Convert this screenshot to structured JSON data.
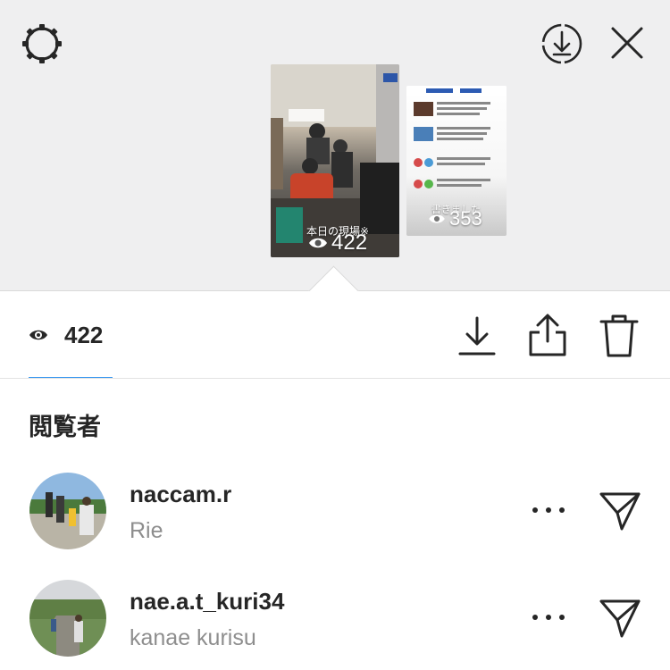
{
  "top": {
    "story_main": {
      "caption": "本日の現場※",
      "views": "422"
    },
    "story_side": {
      "caption": "書きました",
      "views": "353"
    }
  },
  "stats": {
    "views": "422"
  },
  "viewers": {
    "heading": "閲覧者",
    "items": [
      {
        "username": "naccam.r",
        "full_name": "Rie"
      },
      {
        "username": "nae.a.t_kuri34",
        "full_name": "kanae kurisu"
      }
    ]
  },
  "icons": {
    "settings": "gear-icon",
    "save": "download-circle-icon",
    "close": "close-icon",
    "views": "eye-icon",
    "download": "download-icon",
    "share": "share-icon",
    "delete": "trash-icon",
    "more": "more-icon",
    "send": "send-icon"
  },
  "colors": {
    "accent": "#3897f0",
    "top_background": "#efeff0",
    "secondary_text": "#8e8e8e"
  }
}
